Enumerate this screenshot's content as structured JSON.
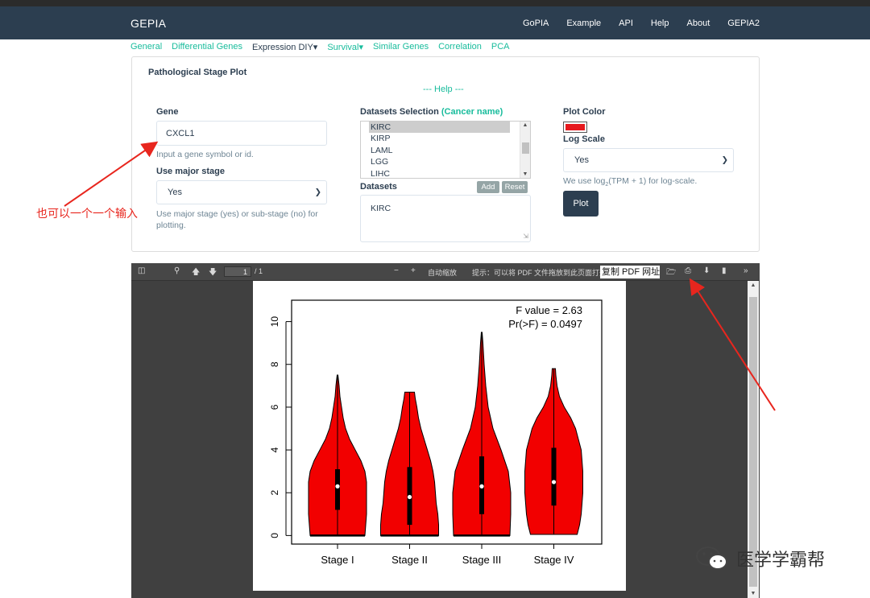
{
  "navbar": {
    "brand": "GEPIA",
    "links": [
      "GoPIA",
      "Example",
      "API",
      "Help",
      "About",
      "GEPIA2"
    ]
  },
  "tabs": [
    {
      "label": "General",
      "active": false
    },
    {
      "label": "Differential Genes",
      "active": false
    },
    {
      "label": "Expression DIY▾",
      "active": true
    },
    {
      "label": "Survival▾",
      "active": false
    },
    {
      "label": "Similar Genes",
      "active": false
    },
    {
      "label": "Correlation",
      "active": false
    },
    {
      "label": "PCA",
      "active": false
    }
  ],
  "panel": {
    "title": "Pathological Stage Plot",
    "help": "--- Help ---",
    "gene": {
      "label": "Gene",
      "value": "CXCL1",
      "hint": "Input a gene symbol or id."
    },
    "major_stage": {
      "label": "Use major stage",
      "value": "Yes",
      "hint": "Use major stage (yes) or sub-stage (no) for plotting."
    },
    "datasets_selection": {
      "label": "Datasets Selection",
      "label_note": "(Cancer name)",
      "options": [
        "KIRC",
        "KIRP",
        "LAML",
        "LGG",
        "LIHC"
      ],
      "selected": "KIRC",
      "add": "Add",
      "reset": "Reset"
    },
    "datasets": {
      "label": "Datasets",
      "value": "KIRC"
    },
    "plot_color": {
      "label": "Plot Color",
      "color": "#e6191e"
    },
    "log_scale": {
      "label": "Log Scale",
      "value": "Yes",
      "hint_prefix": "We use log",
      "hint_sub": "2",
      "hint_suffix": "(TPM + 1) for log-scale."
    },
    "plot_button": "Plot"
  },
  "viewer": {
    "page_number": "1",
    "page_total": "/ 1",
    "zoom_label": "自动缩放",
    "tip": "提示：可以将 PDF 文件拖放到此页面打开",
    "copy_url": "复制 PDF 网址",
    "more": "»"
  },
  "chart_data": {
    "type": "violin",
    "categories": [
      "Stage I",
      "Stage II",
      "Stage III",
      "Stage IV"
    ],
    "medians": [
      2.3,
      1.8,
      2.3,
      2.5
    ],
    "q1": [
      1.2,
      0.5,
      1.0,
      1.4
    ],
    "q3": [
      3.1,
      3.2,
      3.7,
      4.1
    ],
    "min": [
      0.0,
      0.0,
      0.0,
      0.05
    ],
    "max": [
      7.5,
      6.7,
      9.5,
      7.8
    ],
    "ylim": [
      -0.4,
      11
    ],
    "yticks": [
      0,
      2,
      4,
      6,
      8,
      10
    ],
    "fill": "#f20000",
    "annotations": [
      "F value = 2.63",
      "Pr(>F) = 0.0497"
    ]
  },
  "annotation": {
    "text": "也可以一个一个输入"
  },
  "watermark": {
    "text": "医学学霸帮"
  }
}
